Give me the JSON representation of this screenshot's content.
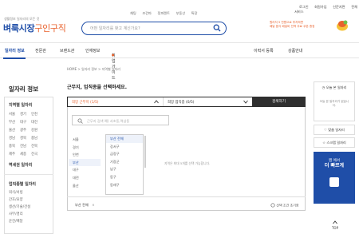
{
  "header": {
    "logo_sub": "생활정보 일자리의 모든 것",
    "logo_main": "벼룩시장",
    "logo_accent": "구인구직",
    "search_placeholder": "어떤 일자리를 찾고 계신가요?",
    "top_links": [
      "채팅",
      "조건마",
      "정피렌트",
      "부동산",
      "특장"
    ],
    "util_links": [
      "로그인",
      "회원가입",
      "신문지면",
      "전체서비스"
    ],
    "promo_line1": "원리지 5 만원으로 투자하면",
    "promo_line2": "배달 음식 배달비 전액 무료 쿠폰 증정"
  },
  "gnb": {
    "items": [
      "일자리 정보",
      "전문관",
      "브랜드관",
      "인재정보",
      "취업가이드"
    ],
    "right_items": [
      "이력서 등록",
      "상품안내"
    ],
    "new_mark": "●"
  },
  "sidebar": {
    "title": "일자리 정보",
    "region_title": "지역별 일자리",
    "regions": [
      "서울",
      "경기",
      "인천",
      "부산",
      "대구",
      "대전",
      "울산",
      "광주",
      "강원",
      "경남",
      "경북",
      "충남",
      "충북",
      "전남",
      "전북",
      "제주",
      "세종",
      "전국"
    ],
    "station_title": "역세권 일자리",
    "job_title": "업직종별 일자리",
    "jobs": [
      "외식/서빙",
      "간호/요양",
      "생산/기술/건설",
      "사무/경리",
      "운전/배달"
    ]
  },
  "main": {
    "breadcrumb": "HOME > 일자리 정보 > 지역별 일자리",
    "headline": "근무지, 업직종을 선택하세요.",
    "sel_region": "희망 근무지 (1/5)",
    "sel_job": "희망 업직종 (0/5)",
    "apply_button": "검색하기",
    "keyword_placeholder": "근무지 검색 예) 서초동,역삼동",
    "sido": [
      "서울",
      "경기",
      "인천",
      "부산",
      "대구",
      "대전",
      "울산"
    ],
    "gugun": [
      "부산 전체",
      "강서구",
      "금정구",
      "기장군",
      "남구",
      "동구",
      "동래구"
    ],
    "hint": "지역은 최대 5개를 선택 가능합니다.",
    "chip": "부산 전체",
    "chip_close": "×",
    "reset": "선택 조건 초기화"
  },
  "rightbar": {
    "today_title": "오늘 본 일자리",
    "today_empty": "오늘 본 일자리가 없습니다.",
    "recent_title": "맞춤 일자리",
    "scrap_title": "스크랩 일자리",
    "ad_line1": "앱 에서",
    "ad_line2": "더 빠르게",
    "top": "TOP"
  }
}
